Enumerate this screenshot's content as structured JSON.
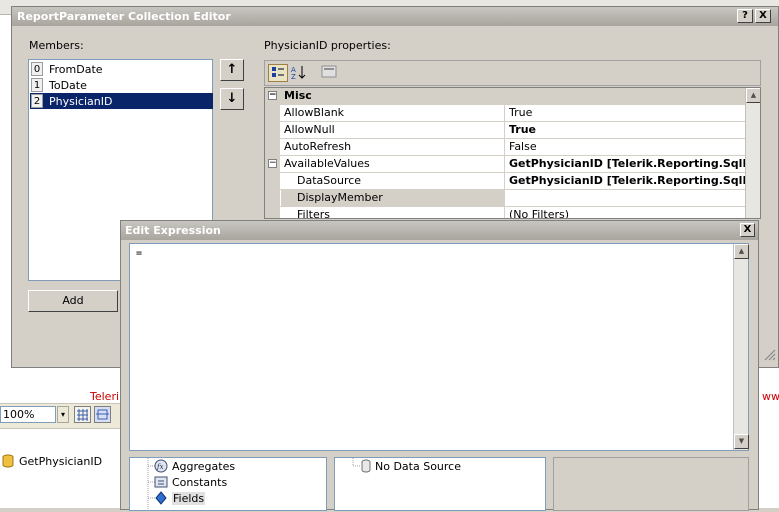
{
  "background": {
    "zoom_value": "100%",
    "zoom_caret": "▾",
    "red_text_left": "Teleri",
    "red_text_right": "www",
    "datasource_item": "GetPhysicianID"
  },
  "main_dialog": {
    "title": "ReportParameter Collection Editor",
    "help_button": "?",
    "close_button": "X",
    "members_label": "Members:",
    "members": [
      {
        "index": "0",
        "name": "FromDate"
      },
      {
        "index": "1",
        "name": "ToDate"
      },
      {
        "index": "2",
        "name": "PhysicianID"
      }
    ],
    "move_up": "↑",
    "move_down": "↓",
    "add_button": "Add",
    "properties_label": "PhysicianID properties:",
    "properties_category": "Misc",
    "properties": [
      {
        "name": "AllowBlank",
        "value": "True",
        "bold": false
      },
      {
        "name": "AllowNull",
        "value": "True",
        "bold": true
      },
      {
        "name": "AutoRefresh",
        "value": "False",
        "bold": false
      },
      {
        "name": "AvailableValues",
        "value": "GetPhysicianID [Telerik.Reporting.SqlData",
        "bold": true
      },
      {
        "name": "DataSource",
        "value": "GetPhysicianID [Telerik.Reporting.SqlData",
        "bold": true
      },
      {
        "name": "DisplayMember",
        "value": "",
        "bold": false
      },
      {
        "name": "Filters",
        "value": "(No Filters)",
        "bold": false
      }
    ]
  },
  "edit_expression": {
    "title": "Edit Expression",
    "close_button": "X",
    "expression_text": "=",
    "tree_items": [
      "Aggregates",
      "Constants",
      "Fields"
    ],
    "middle_item": "No Data Source"
  },
  "colors": {
    "selection": "#0a246a",
    "titlebar": "#b0aea8",
    "dialog_face": "#d4d0c8"
  }
}
